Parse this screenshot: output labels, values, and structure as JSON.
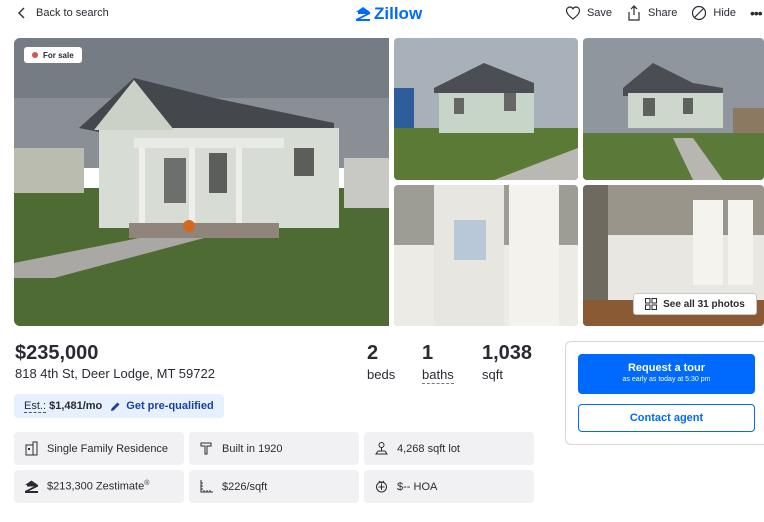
{
  "topbar": {
    "back_label": "Back to search",
    "logo_text": "Zillow",
    "actions": {
      "save": "Save",
      "share": "Share",
      "hide": "Hide",
      "more": "•••"
    }
  },
  "gallery": {
    "badge": "For sale",
    "see_all": "See all 31 photos"
  },
  "listing": {
    "price": "$235,000",
    "address": "818 4th St, Deer Lodge, MT 59722",
    "beds": {
      "value": "2",
      "label": "beds"
    },
    "baths": {
      "value": "1",
      "label": "baths"
    },
    "sqft": {
      "value": "1,038",
      "label": "sqft"
    }
  },
  "estimate": {
    "label": "Est.:",
    "value": "$1,481/mo",
    "prequal": "Get pre-qualified"
  },
  "facts": {
    "type": "Single Family Residence",
    "built": "Built in 1920",
    "lot": "4,268 sqft lot",
    "zestimate": "$213,300 Zestimate",
    "zestimate_mark": "®",
    "price_per_sqft": "$226/sqft",
    "hoa": "$-- HOA"
  },
  "agent": {
    "tour_title": "Request a tour",
    "tour_sub": "as early as today at 5:30 pm",
    "contact": "Contact agent"
  },
  "colors": {
    "brand": "#006aff",
    "est_bg": "#e6f0ff",
    "chip_bg": "#f1f1f4",
    "badge_dot": "#d9534f"
  }
}
